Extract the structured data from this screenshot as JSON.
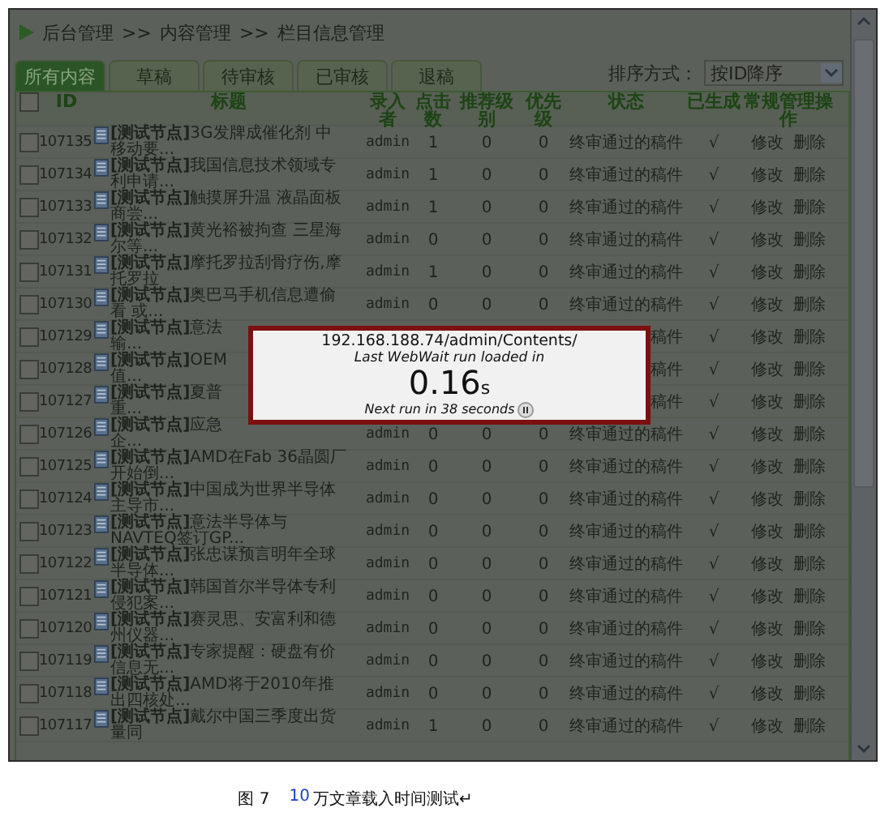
{
  "breadcrumb": [
    "后台管理",
    ">>",
    "内容管理",
    ">>",
    "栏目信息管理"
  ],
  "tabs": [
    {
      "label": "所有内容",
      "selected": true
    },
    {
      "label": "草稿",
      "selected": false
    },
    {
      "label": "待审核",
      "selected": false
    },
    {
      "label": "已审核",
      "selected": false
    },
    {
      "label": "退稿",
      "selected": false
    }
  ],
  "sort": {
    "label": "排序方式：",
    "value": "按ID降序"
  },
  "table": {
    "select_all_checked": false,
    "columns": [
      "ID",
      "标题",
      "录入者",
      "点击数",
      "推荐级别",
      "优先级",
      "状态",
      "已生成",
      "常规管理操作"
    ],
    "rows": [
      {
        "checked": false,
        "id": "107135",
        "title": "**[测试节点]**3G发牌成催化剂 中移动要...",
        "author": "admin",
        "clicks": "1",
        "recommend": "0",
        "priority": "0",
        "status": "终审通过的稿件",
        "generated": "√",
        "actions": [
          "修改",
          "删除"
        ]
      },
      {
        "checked": false,
        "id": "107134",
        "title": "**[测试节点]**我国信息技术领域专利申请...",
        "author": "admin",
        "clicks": "1",
        "recommend": "0",
        "priority": "0",
        "status": "终审通过的稿件",
        "generated": "√",
        "actions": [
          "修改",
          "删除"
        ]
      },
      {
        "checked": false,
        "id": "107133",
        "title": "**[测试节点]**触摸屏升温 液晶面板商尝...",
        "author": "admin",
        "clicks": "1",
        "recommend": "0",
        "priority": "0",
        "status": "终审通过的稿件",
        "generated": "√",
        "actions": [
          "修改",
          "删除"
        ]
      },
      {
        "checked": false,
        "id": "107132",
        "title": "**[测试节点]**黄光裕被拘查 三星海尔等...",
        "author": "admin",
        "clicks": "0",
        "recommend": "0",
        "priority": "0",
        "status": "终审通过的稿件",
        "generated": "√",
        "actions": [
          "修改",
          "删除"
        ]
      },
      {
        "checked": false,
        "id": "107131",
        "title": "**[测试节点]**摩托罗拉刮骨疗伤,摩托罗拉",
        "author": "admin",
        "clicks": "1",
        "recommend": "0",
        "priority": "0",
        "status": "终审通过的稿件",
        "generated": "√",
        "actions": [
          "修改",
          "删除"
        ]
      },
      {
        "checked": false,
        "id": "107130",
        "title": "**[测试节点]**奥巴马手机信息遭偷看 或...",
        "author": "admin",
        "clicks": "0",
        "recommend": "0",
        "priority": "0",
        "status": "终审通过的稿件",
        "generated": "√",
        "actions": [
          "修改",
          "删除"
        ]
      },
      {
        "checked": false,
        "id": "107129",
        "title": "**[测试节点]**意法",
        "title_cont": "输...",
        "status": "稿件",
        "status_cut": true,
        "generated": "√",
        "actions": [
          "修改",
          "删除"
        ]
      },
      {
        "checked": false,
        "id": "107128",
        "title": "**[测试节点]**OEM",
        "title_cont": "值...",
        "status": "稿件",
        "status_cut": true,
        "generated": "√",
        "actions": [
          "修改",
          "删除"
        ]
      },
      {
        "checked": false,
        "id": "107127",
        "title": "**[测试节点]**夏普",
        "title_cont": "重...",
        "status": "稿件",
        "status_cut": true,
        "generated": "√",
        "actions": [
          "修改",
          "删除"
        ]
      },
      {
        "checked": false,
        "id": "107126",
        "title": "**[测试节点]**应急",
        "title_cont": "企...",
        "author": "admin",
        "clicks": "0",
        "recommend": "0",
        "priority": "0",
        "status": "终审通过的稿件",
        "generated": "√",
        "actions": [
          "修改",
          "删除"
        ]
      },
      {
        "checked": false,
        "id": "107125",
        "title": "**[测试节点]**AMD在Fab 36晶圆厂开始倒...",
        "author": "admin",
        "clicks": "0",
        "recommend": "0",
        "priority": "0",
        "status": "终审通过的稿件",
        "generated": "√",
        "actions": [
          "修改",
          "删除"
        ]
      },
      {
        "checked": false,
        "id": "107124",
        "title": "**[测试节点]**中国成为世界半导体主导市...",
        "author": "admin",
        "clicks": "0",
        "recommend": "0",
        "priority": "0",
        "status": "终审通过的稿件",
        "generated": "√",
        "actions": [
          "修改",
          "删除"
        ]
      },
      {
        "checked": false,
        "id": "107123",
        "title": "**[测试节点]**意法半导体与NAVTEQ签订GP...",
        "author": "admin",
        "clicks": "0",
        "recommend": "0",
        "priority": "0",
        "status": "终审通过的稿件",
        "generated": "√",
        "actions": [
          "修改",
          "删除"
        ]
      },
      {
        "checked": false,
        "id": "107122",
        "title": "**[测试节点]**张忠谋预言明年全球半导体...",
        "author": "admin",
        "clicks": "0",
        "recommend": "0",
        "priority": "0",
        "status": "终审通过的稿件",
        "generated": "√",
        "actions": [
          "修改",
          "删除"
        ]
      },
      {
        "checked": false,
        "id": "107121",
        "title": "**[测试节点]**韩国首尔半导体专利侵犯案...",
        "author": "admin",
        "clicks": "0",
        "recommend": "0",
        "priority": "0",
        "status": "终审通过的稿件",
        "generated": "√",
        "actions": [
          "修改",
          "删除"
        ]
      },
      {
        "checked": false,
        "id": "107120",
        "title": "**[测试节点]**赛灵思、安富利和德州仪器...",
        "author": "admin",
        "clicks": "0",
        "recommend": "0",
        "priority": "0",
        "status": "终审通过的稿件",
        "generated": "√",
        "actions": [
          "修改",
          "删除"
        ]
      },
      {
        "checked": false,
        "id": "107119",
        "title": "**[测试节点]**专家提醒：硬盘有价信息无...",
        "author": "admin",
        "clicks": "0",
        "recommend": "0",
        "priority": "0",
        "status": "终审通过的稿件",
        "generated": "√",
        "actions": [
          "修改",
          "删除"
        ]
      },
      {
        "checked": false,
        "id": "107118",
        "title": "**[测试节点]**AMD将于2010年推出四核处...",
        "author": "admin",
        "clicks": "0",
        "recommend": "0",
        "priority": "0",
        "status": "终审通过的稿件",
        "generated": "√",
        "actions": [
          "修改",
          "删除"
        ]
      },
      {
        "checked": false,
        "id": "107117",
        "title": "**[测试节点]**戴尔中国三季度出货量同",
        "author": "admin",
        "clicks": "1",
        "recommend": "0",
        "priority": "0",
        "status": "终审通过的稿件",
        "generated": "√",
        "actions": [
          "修改",
          "删除"
        ]
      }
    ]
  },
  "popup": {
    "url": "192.168.188.74/admin/Contents/",
    "caption": "Last WebWait run loaded in",
    "time": "0.16",
    "unit": "s",
    "next_run": "Next run in 38 seconds"
  },
  "caption": {
    "label": "图 7",
    "number": "10",
    "text": "万文章载入时间测试↵"
  }
}
